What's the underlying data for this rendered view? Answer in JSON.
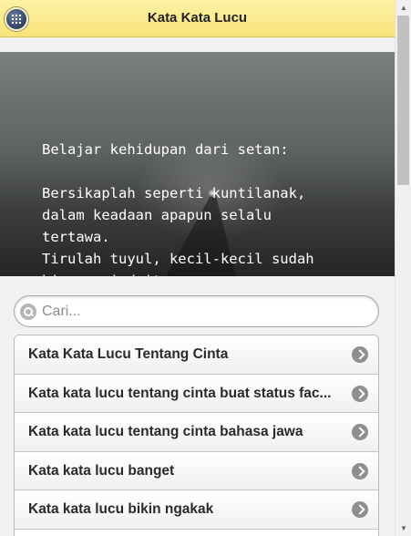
{
  "header": {
    "title": "Kata Kata Lucu",
    "menu_icon": "grid-menu-icon"
  },
  "banner": {
    "text": "Belajar kehidupan dari setan:\n\nBersikaplah seperti kuntilanak,\ndalam keadaan apapun selalu\ntertawa.\nTirulah tuyul, kecil-kecil sudah\nbisa cari duit."
  },
  "search": {
    "placeholder": "Cari...",
    "value": ""
  },
  "list": {
    "items": [
      {
        "label": "Kata Kata Lucu Tentang Cinta"
      },
      {
        "label": "Kata kata lucu tentang cinta buat status fac..."
      },
      {
        "label": "Kata kata lucu tentang cinta bahasa jawa"
      },
      {
        "label": "Kata kata lucu banget"
      },
      {
        "label": "Kata kata lucu bikin ngakak"
      }
    ]
  },
  "scrollbar": {
    "up_arrow": "▲",
    "down_arrow": "▼"
  }
}
